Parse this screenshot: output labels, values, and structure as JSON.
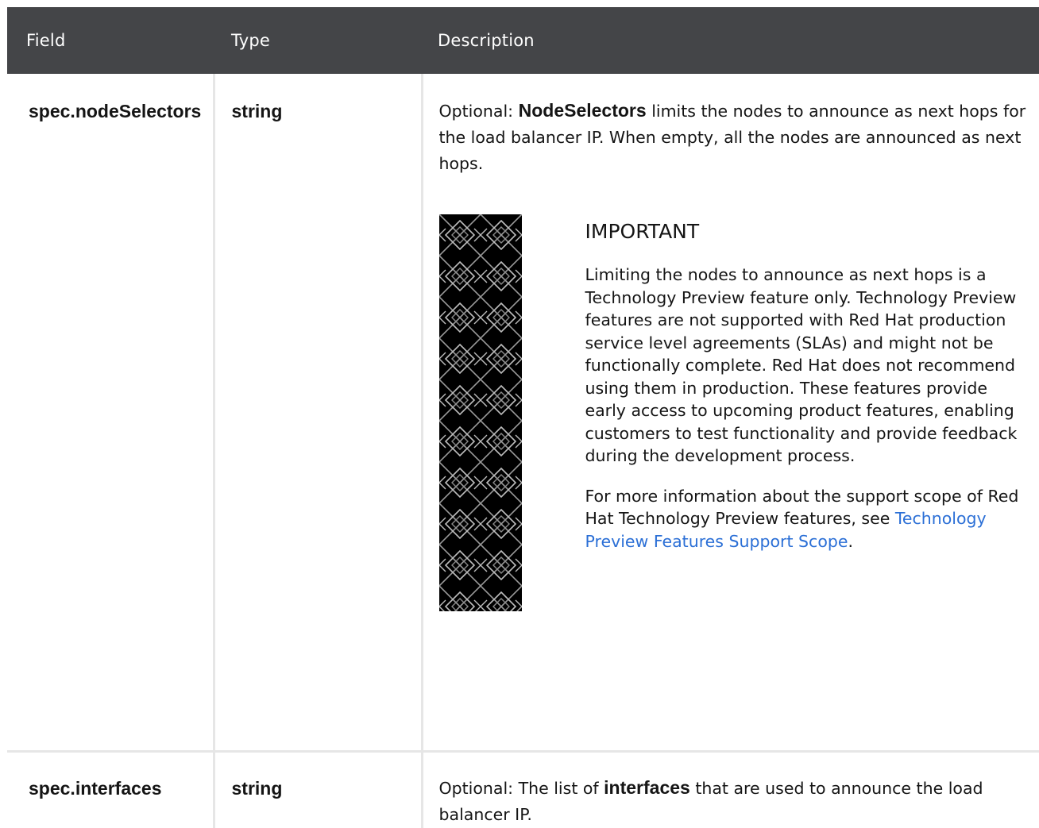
{
  "table": {
    "headers": {
      "field": "Field",
      "type": "Type",
      "description": "Description"
    },
    "rows": [
      {
        "field": "spec.nodeSelectors",
        "type": "string",
        "desc_prefix": "Optional: ",
        "desc_keyword": "NodeSelectors",
        "desc_suffix": " limits the nodes to announce as next hops for the load balancer IP. When empty, all the nodes are announced as next hops.",
        "admonition": {
          "title": "IMPORTANT",
          "paragraph_1": "Limiting the nodes to announce as next hops is a Technology Preview feature only. Technology Preview features are not supported with Red Hat production service level agreements (SLAs) and might not be functionally complete. Red Hat does not recommend using them in production. These features provide early access to upcoming product features, enabling customers to test functionality and provide feedback during the development process.",
          "paragraph_2": "For more information about the support scope of Red Hat Technology Preview features, see ",
          "link_text": "Technology Preview Features Support Scope",
          "link_suffix": "."
        }
      },
      {
        "field": "spec.interfaces",
        "type": "string",
        "desc_prefix": "Optional: The list of ",
        "desc_keyword": "interfaces",
        "desc_suffix": " that are used to announce the load balancer IP."
      }
    ]
  },
  "colors": {
    "header_bg": "#444548",
    "link": "#2b6fd6",
    "border": "#e6e6e6",
    "admonition_band": "#000000"
  }
}
